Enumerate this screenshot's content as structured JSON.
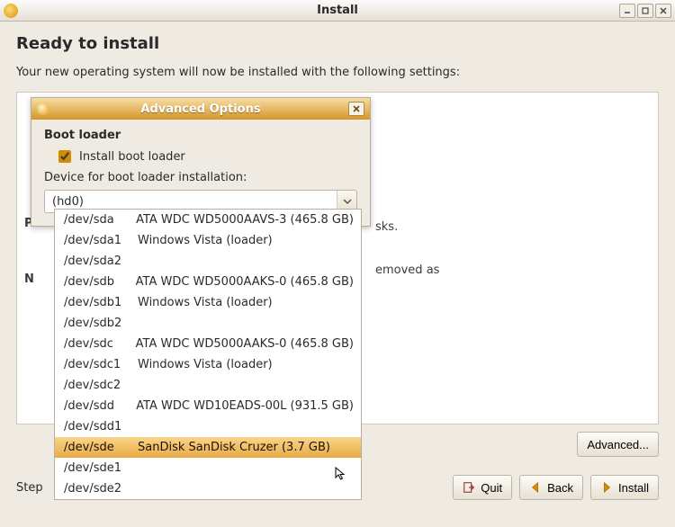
{
  "window": {
    "title": "Install"
  },
  "page": {
    "heading": "Ready to install",
    "lead": "Your new operating system will now be installed with the following settings:",
    "bg_text": {
      "l1_visible": "sks.",
      "l2_visible": "emoved as"
    },
    "partition_label_prefix": "P",
    "network_label_prefix": "N",
    "advanced_button": "Advanced...",
    "step": "Step"
  },
  "buttons": {
    "quit": "Quit",
    "back": "Back",
    "install": "Install"
  },
  "dialog": {
    "title": "Advanced Options",
    "section": "Boot loader",
    "checkbox_label": "Install boot loader",
    "checkbox_checked": true,
    "device_label": "Device for boot loader installation:",
    "selected_value": "(hd0)"
  },
  "dropdown": {
    "items": [
      {
        "dev": "/dev/sda",
        "desc": "ATA WDC WD5000AAVS-3 (465.8 GB)"
      },
      {
        "dev": "/dev/sda1",
        "desc": "Windows Vista (loader)"
      },
      {
        "dev": "/dev/sda2",
        "desc": ""
      },
      {
        "dev": "/dev/sdb",
        "desc": "ATA WDC WD5000AAKS-0 (465.8 GB)"
      },
      {
        "dev": "/dev/sdb1",
        "desc": "Windows Vista (loader)"
      },
      {
        "dev": "/dev/sdb2",
        "desc": ""
      },
      {
        "dev": "/dev/sdc",
        "desc": "ATA WDC WD5000AAKS-0 (465.8 GB)"
      },
      {
        "dev": "/dev/sdc1",
        "desc": "Windows Vista (loader)"
      },
      {
        "dev": "/dev/sdc2",
        "desc": ""
      },
      {
        "dev": "/dev/sdd",
        "desc": "ATA WDC WD10EADS-00L (931.5 GB)"
      },
      {
        "dev": "/dev/sdd1",
        "desc": ""
      },
      {
        "dev": "/dev/sde",
        "desc": "SanDisk SanDisk Cruzer (3.7 GB)",
        "selected": true
      },
      {
        "dev": "/dev/sde1",
        "desc": ""
      },
      {
        "dev": "/dev/sde2",
        "desc": ""
      }
    ]
  }
}
